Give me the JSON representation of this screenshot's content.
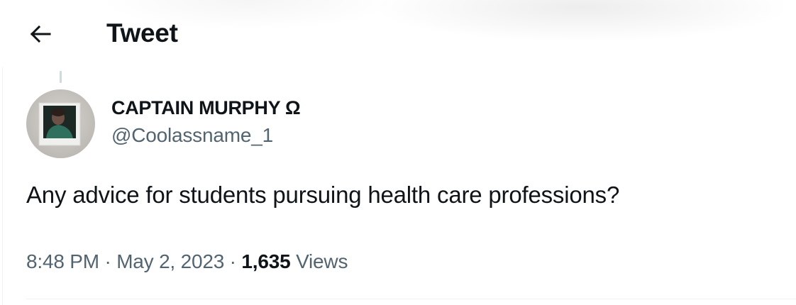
{
  "header": {
    "back_icon": "arrow-left-icon",
    "title": "Tweet"
  },
  "tweet": {
    "author": {
      "display_name": "CAPTAIN MURPHY Ω",
      "handle": "@Coolassname_1",
      "avatar_icon": "profile-photo"
    },
    "text": "Any advice for students pursuing health care professions?",
    "time": "8:48 PM",
    "separator": " · ",
    "date": "May 2, 2023",
    "views_count": "1,635",
    "views_label": "Views"
  },
  "colors": {
    "text_primary": "#0f1419",
    "text_secondary": "#536471",
    "divider": "#eff3f4",
    "thread_line": "#cfd9de"
  }
}
